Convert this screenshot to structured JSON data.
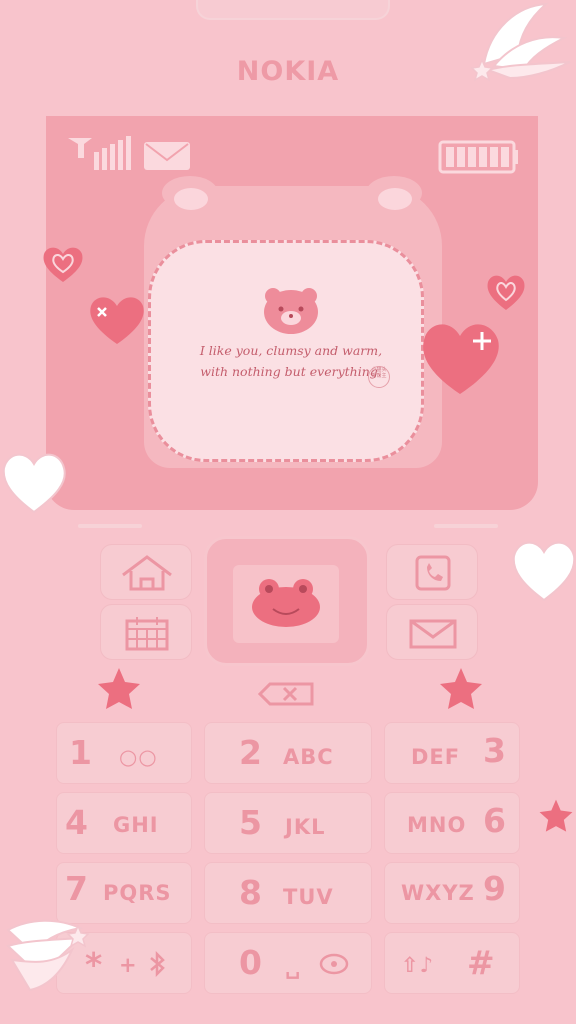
{
  "brand": "NOKIA",
  "screen": {
    "message": "I like you, clumsy and warm, with nothing but everything.",
    "seal_text": "小猫头 帮帮主"
  },
  "keys": [
    {
      "name": "key-1",
      "digit": "1",
      "letters": "○○"
    },
    {
      "name": "key-2",
      "digit": "2",
      "letters": "ABC"
    },
    {
      "name": "key-3",
      "digit": "3",
      "letters": "DEF"
    },
    {
      "name": "key-4",
      "digit": "4",
      "letters": "GHI"
    },
    {
      "name": "key-5",
      "digit": "5",
      "letters": "JKL"
    },
    {
      "name": "key-6",
      "digit": "6",
      "letters": "MNO"
    },
    {
      "name": "key-7",
      "digit": "7",
      "letters": "PQRS"
    },
    {
      "name": "key-8",
      "digit": "8",
      "letters": "TUV"
    },
    {
      "name": "key-9",
      "digit": "9",
      "letters": "WXYZ"
    },
    {
      "name": "key-star",
      "digit": "*",
      "letters": "+"
    },
    {
      "name": "key-0",
      "digit": "0",
      "letters": "␣"
    },
    {
      "name": "key-hash",
      "digit": "#",
      "letters": "⇧♪"
    }
  ],
  "icons": {
    "top_left": "home-icon",
    "top_right": "phone-icon",
    "bottom_left": "calendar-icon",
    "bottom_right": "mail-icon",
    "center": "frog-icon",
    "clear": "backspace-icon"
  },
  "colors": {
    "background": "#f8c4cc",
    "screen": "#f2a3ae",
    "accent": "#ec96a3"
  }
}
